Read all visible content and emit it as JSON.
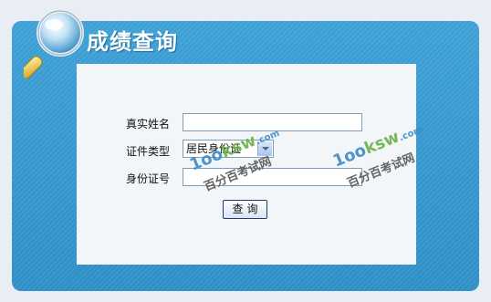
{
  "header": {
    "title": "成绩查询"
  },
  "form": {
    "name_label": "真实姓名",
    "name_value": "",
    "doc_type_label": "证件类型",
    "doc_type_selected": "居民身份证",
    "id_label": "身份证号",
    "id_value": "",
    "submit_label": "查询"
  },
  "watermarks": [
    {
      "logo": "1oo",
      "logo_accent": "ksw",
      "domain": ".com",
      "text": "百分百考试网"
    },
    {
      "logo": "1oo",
      "logo_accent": "ksw",
      "domain": ".com",
      "text": "百分百考试网"
    }
  ],
  "colors": {
    "panel": "#3ea1d6",
    "inner": "#f3f6f9",
    "title": "#ffffff"
  },
  "icons": {
    "header": "magnifier-icon",
    "select": "chevron-down-icon"
  }
}
